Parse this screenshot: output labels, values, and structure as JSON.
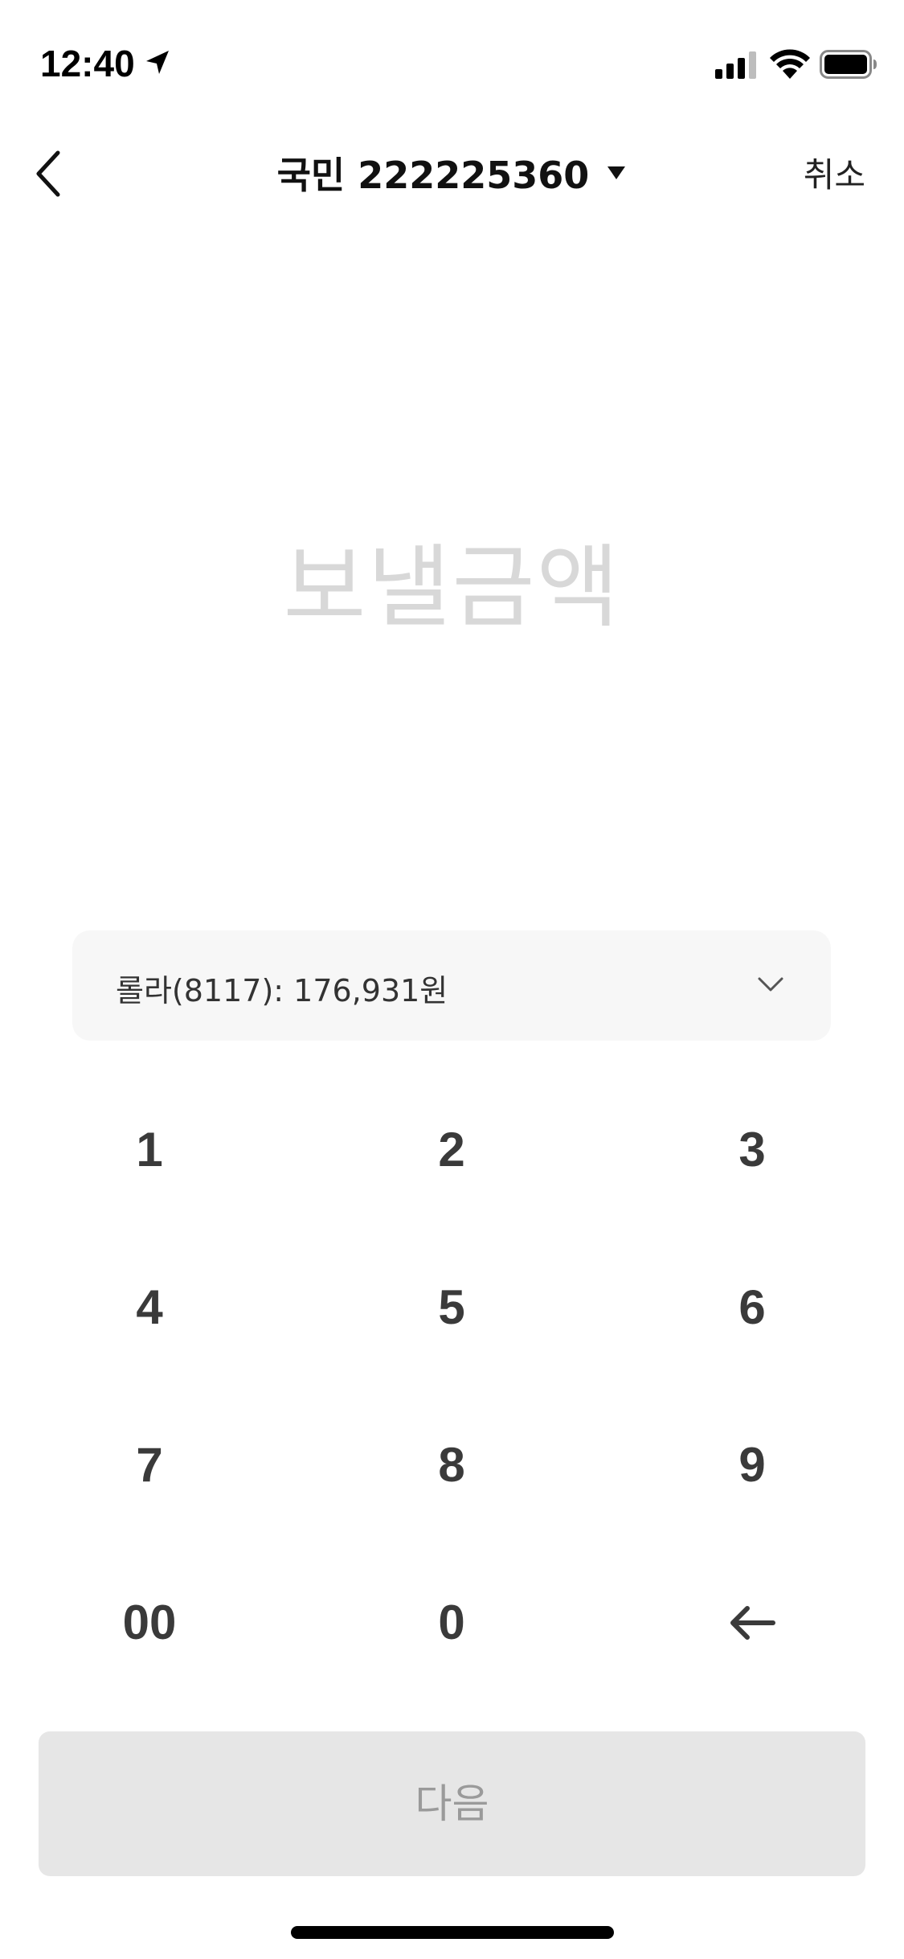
{
  "status_bar": {
    "time": "12:40",
    "icons": [
      "location-arrow-icon",
      "cellular-signal-icon",
      "wifi-icon",
      "battery-icon"
    ]
  },
  "nav": {
    "back_icon": "chevron-left-icon",
    "title": "국민 222225360",
    "title_caret_icon": "caret-down-icon",
    "cancel_label": "취소"
  },
  "amount": {
    "placeholder": "보낼금액"
  },
  "account_selector": {
    "text": "롤라(8117): 176,931원",
    "icon": "chevron-down-icon"
  },
  "keypad": {
    "keys": [
      "1",
      "2",
      "3",
      "4",
      "5",
      "6",
      "7",
      "8",
      "9",
      "00",
      "0"
    ],
    "backspace_icon": "arrow-left-icon"
  },
  "next_button": {
    "label": "다음"
  },
  "colors": {
    "placeholder_text": "#d8d8d8",
    "selector_bg": "#f7f7f7",
    "key_text": "#3a3a3a",
    "next_button_bg": "#e6e6e6",
    "next_button_text": "#9a9a9a"
  }
}
